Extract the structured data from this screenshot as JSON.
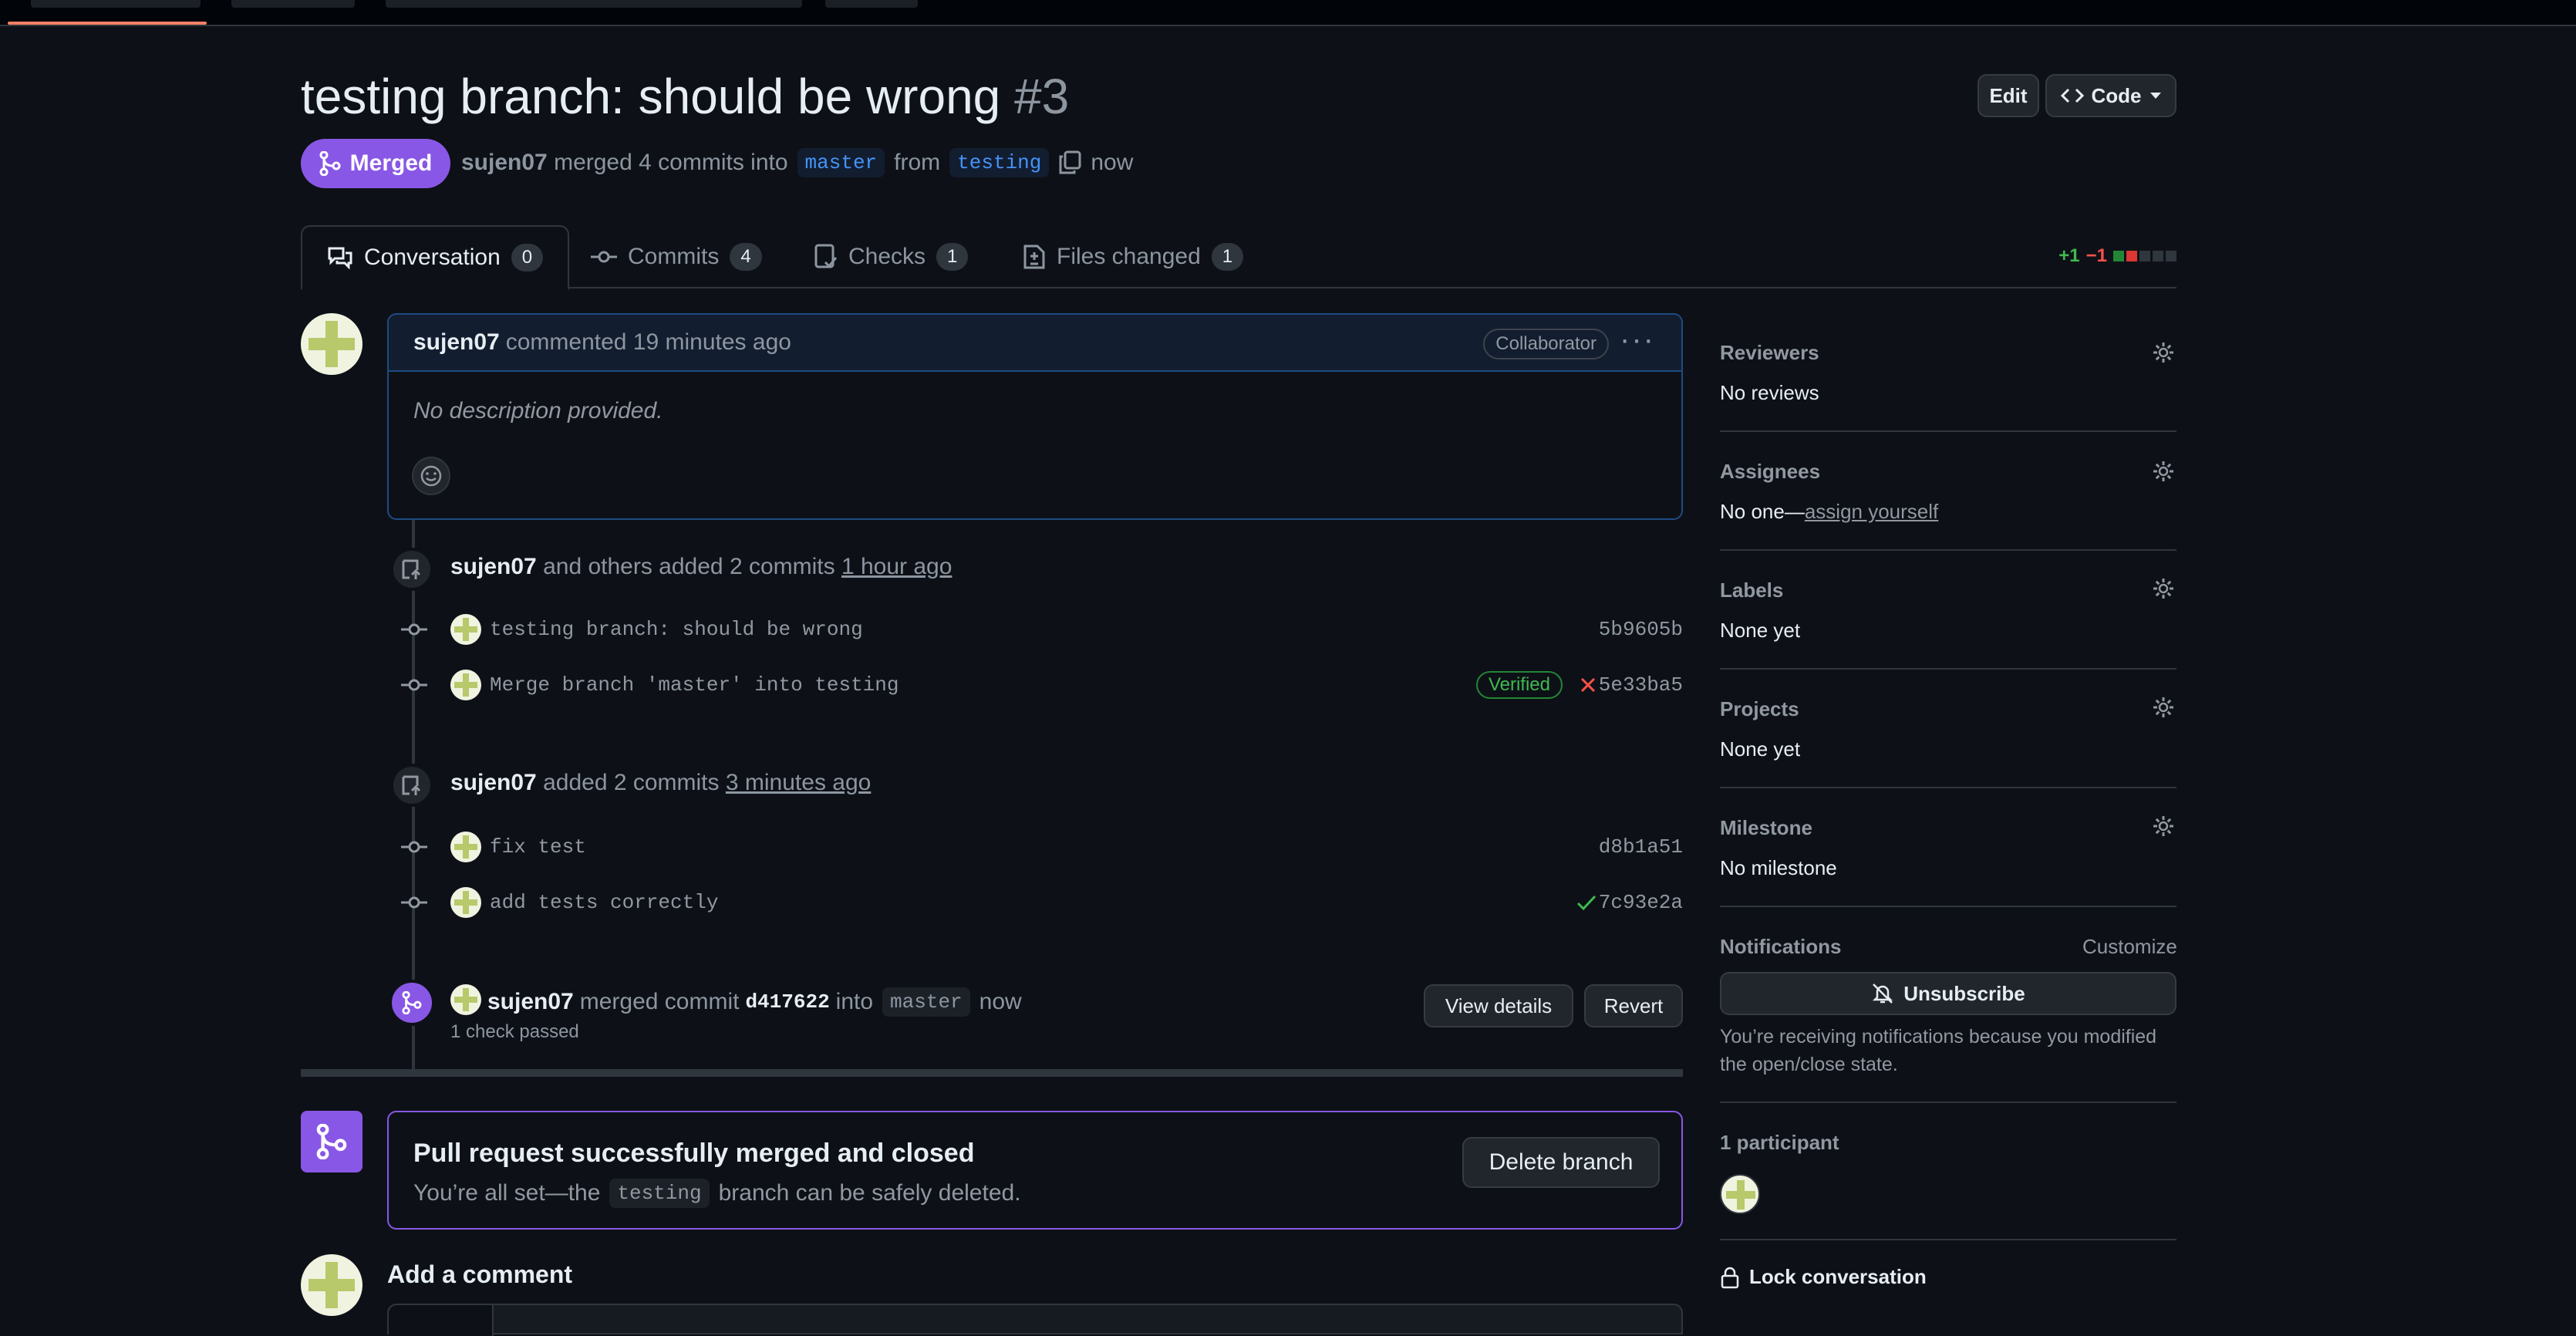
{
  "pr": {
    "title": "testing branch: should be wrong",
    "number": "#3",
    "state": "Merged",
    "author": "sujen07",
    "merged_text": "merged 4 commits into",
    "base_branch": "master",
    "from_text": "from",
    "head_branch": "testing",
    "time": "now"
  },
  "header_buttons": {
    "edit": "Edit",
    "code": "Code"
  },
  "tabs": [
    {
      "label": "Conversation",
      "count": "0"
    },
    {
      "label": "Commits",
      "count": "4"
    },
    {
      "label": "Checks",
      "count": "1"
    },
    {
      "label": "Files changed",
      "count": "1"
    }
  ],
  "diffstat": {
    "additions": "+1",
    "deletions": "−1"
  },
  "comment": {
    "author": "sujen07",
    "action": "commented 19 minutes ago",
    "role": "Collaborator",
    "body": "No description provided."
  },
  "timeline": {
    "group1": {
      "author": "sujen07",
      "text": "and others added 2 commits",
      "time": "1 hour ago"
    },
    "group2": {
      "author": "sujen07",
      "text": "added 2 commits",
      "time": "3 minutes ago"
    },
    "commits": [
      {
        "message": "testing branch: should be wrong",
        "sha": "5b9605b"
      },
      {
        "message": "Merge branch 'master' into testing",
        "sha": "5e33ba5",
        "badge": "Verified",
        "status": "failure"
      },
      {
        "message": "fix test",
        "sha": "d8b1a51"
      },
      {
        "message": "add tests correctly",
        "sha": "7c93e2a",
        "status": "success"
      }
    ],
    "merge": {
      "author": "sujen07",
      "text": "merged commit",
      "commit": "d417622",
      "into": "into",
      "branch": "master",
      "time": "now",
      "checks": "1 check passed",
      "view_details": "View details",
      "revert": "Revert"
    }
  },
  "merged_box": {
    "title": "Pull request successfully merged and closed",
    "text_before": "You’re all set—the",
    "branch": "testing",
    "text_after": "branch can be safely deleted.",
    "delete_button": "Delete branch"
  },
  "add_comment": {
    "title": "Add a comment"
  },
  "sidebar": {
    "reviewers": {
      "label": "Reviewers",
      "value": "No reviews"
    },
    "assignees": {
      "label": "Assignees",
      "value": "No one—",
      "link": "assign yourself"
    },
    "labels": {
      "label": "Labels",
      "value": "None yet"
    },
    "projects": {
      "label": "Projects",
      "value": "None yet"
    },
    "milestone": {
      "label": "Milestone",
      "value": "No milestone"
    },
    "notifications": {
      "label": "Notifications",
      "customize": "Customize",
      "button": "Unsubscribe",
      "reason": "You’re receiving notifications because you modified the open/close state."
    },
    "participants": {
      "label": "1 participant"
    },
    "lock": "Lock conversation"
  },
  "colors": {
    "merged": "#8957e5",
    "link": "#4493f8",
    "success": "#3fb950",
    "danger": "#f85149"
  }
}
